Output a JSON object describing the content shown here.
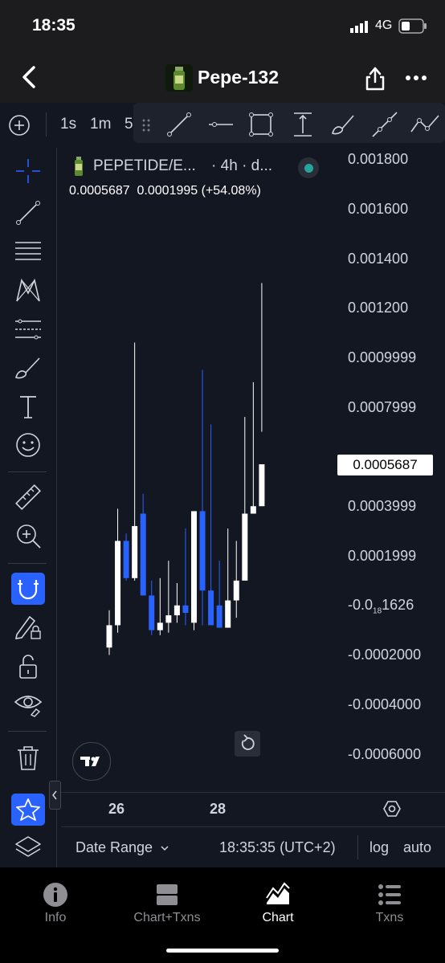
{
  "status_bar": {
    "time": "18:35",
    "network": "4G"
  },
  "header": {
    "title": "Pepe-132",
    "logo_icon": "bottle-icon"
  },
  "toolbar": {
    "timeframes": [
      "1s",
      "1m",
      "5"
    ]
  },
  "chart": {
    "symbol": "PEPETIDE/E...",
    "interval": "· 4h · d...",
    "legend_values": "0.0005687  0.0001995 (+54.08%)",
    "y_ticks": [
      "0.001800",
      "0.001600",
      "0.001400",
      "0.001200",
      "0.0009999",
      "0.0007999",
      "0.0003999",
      "0.0001999",
      "-0.0",
      "-0.0002000",
      "-0.0004000",
      "-0.0006000"
    ],
    "y_tick_small": {
      "main": "-0.0",
      "sub": "18",
      "tail": "1626"
    },
    "last_price": "0.0005687",
    "x_ticks": [
      "26",
      "28"
    ],
    "candles_up_color": "#ffffff",
    "candles_down_color": "#2962ff"
  },
  "chart_data": {
    "type": "candlestick",
    "x": [
      "c1",
      "c2",
      "c3",
      "c4",
      "c5",
      "c6",
      "c7",
      "c8",
      "c9",
      "c10",
      "c11",
      "c12",
      "c13",
      "c14",
      "c15",
      "c16",
      "c17",
      "c18",
      "c19"
    ],
    "series": [
      {
        "open": [
          -0.00017,
          -8e-05,
          0.00026,
          0.00011,
          0.00037,
          4e-05,
          -0.0001,
          -7e-05,
          -4e-05,
          0.0,
          -7e-05,
          0.00038,
          6e-05,
          0.0,
          -9e-05,
          2e-05,
          0.0001,
          0.00037,
          0.0004
        ],
        "high": [
          -2e-05,
          0.00039,
          0.00029,
          0.00106,
          0.00045,
          0.0001,
          0.00011,
          0.00018,
          9e-05,
          0.00031,
          0.00031,
          0.00095,
          0.00073,
          0.00018,
          0.00031,
          0.00026,
          0.00076,
          0.0009,
          0.0013
        ],
        "low": [
          -0.0002,
          -0.00011,
          0.0001,
          0.0001,
          4e-05,
          -0.00012,
          -0.00012,
          -0.00011,
          -7e-05,
          -8e-05,
          -0.0001,
          -8e-05,
          -3e-05,
          -8e-05,
          -6e-05,
          -5e-05,
          0.00013,
          0.00037,
          0.0007
        ],
        "close": [
          -8e-05,
          0.00026,
          0.00011,
          0.00032,
          4e-05,
          -0.0001,
          -7e-05,
          -4e-05,
          0.0,
          -3e-05,
          0.00038,
          6e-05,
          -8e-05,
          -9e-05,
          2e-05,
          0.0001,
          0.00037,
          0.0004,
          0.000569
        ]
      }
    ],
    "ylim": [
      -0.00065,
      0.00185
    ],
    "last_value": 0.0005687
  },
  "bottom": {
    "date_range": "Date Range",
    "clock": "18:35:35 (UTC+2)",
    "log": "log",
    "auto": "auto"
  },
  "tabs": [
    {
      "label": "Info",
      "icon": "info-icon"
    },
    {
      "label": "Chart+Txns",
      "icon": "split-icon"
    },
    {
      "label": "Chart",
      "icon": "chart-icon",
      "active": true
    },
    {
      "label": "Txns",
      "icon": "list-icon"
    }
  ]
}
